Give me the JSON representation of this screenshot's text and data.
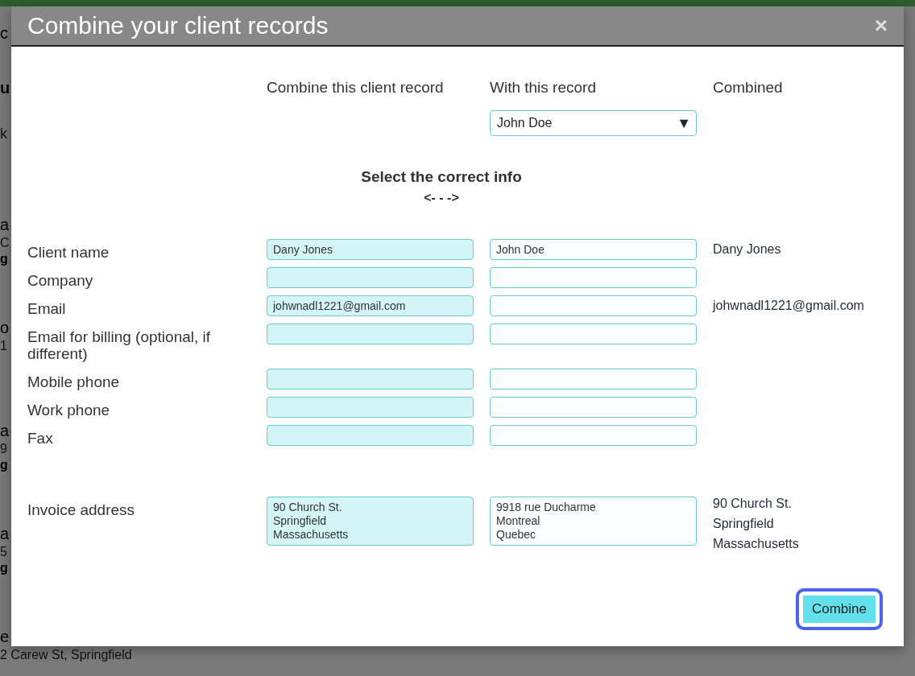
{
  "background": {
    "header": "c",
    "heading": "u",
    "search": "k",
    "clients": [
      {
        "name": "a",
        "line": "C",
        "tag": "g"
      },
      {
        "name": "o",
        "line": "1"
      },
      {
        "name": "a",
        "line": "9",
        "tag": "g"
      },
      {
        "name": "a",
        "line": "5",
        "tag": "g"
      },
      {
        "name": "e",
        "line": "2 Carew St, Springfield"
      }
    ]
  },
  "modal": {
    "title": "Combine your client records",
    "close": "×",
    "columns": [
      "Combine this client record",
      "With this record",
      "Combined"
    ],
    "record_select": {
      "value": "John Doe",
      "caret": "▼"
    },
    "instruction": "Select the correct info",
    "arrow": "<- - ->",
    "fields": [
      {
        "label": "Client name",
        "kind": "line",
        "source_selected": true,
        "target_selected": false,
        "source": "Dany Jones",
        "target": "John Doe",
        "combined": "Dany Jones"
      },
      {
        "label": "Company",
        "kind": "line",
        "source_selected": true,
        "target_selected": false
      },
      {
        "label": "Email",
        "kind": "line",
        "source_selected": true,
        "target_selected": false,
        "source": "johwnadl1221@gmail.com",
        "combined": "johwnadl1221@gmail.com"
      },
      {
        "label": "Email for billing (optional, if different)",
        "kind": "line",
        "source_selected": true,
        "target_selected": false
      },
      {
        "label": "Mobile phone",
        "kind": "line",
        "source_selected": true,
        "target_selected": false
      },
      {
        "label": "Work phone",
        "kind": "line",
        "source_selected": true,
        "target_selected": false
      },
      {
        "label": "Fax",
        "kind": "line",
        "source_selected": true,
        "target_selected": false
      },
      {
        "label": "Invoice address",
        "kind": "address",
        "source_selected": true,
        "target_selected": false,
        "source": "90 Church St.\nSpringfield\nMassachusetts",
        "target": "9918 rue Ducharme\nMontreal\nQuebec",
        "combined": "90 Church St.\nSpringfield\nMassachusetts"
      }
    ],
    "button": {
      "label": "Combine",
      "focused": true
    }
  }
}
